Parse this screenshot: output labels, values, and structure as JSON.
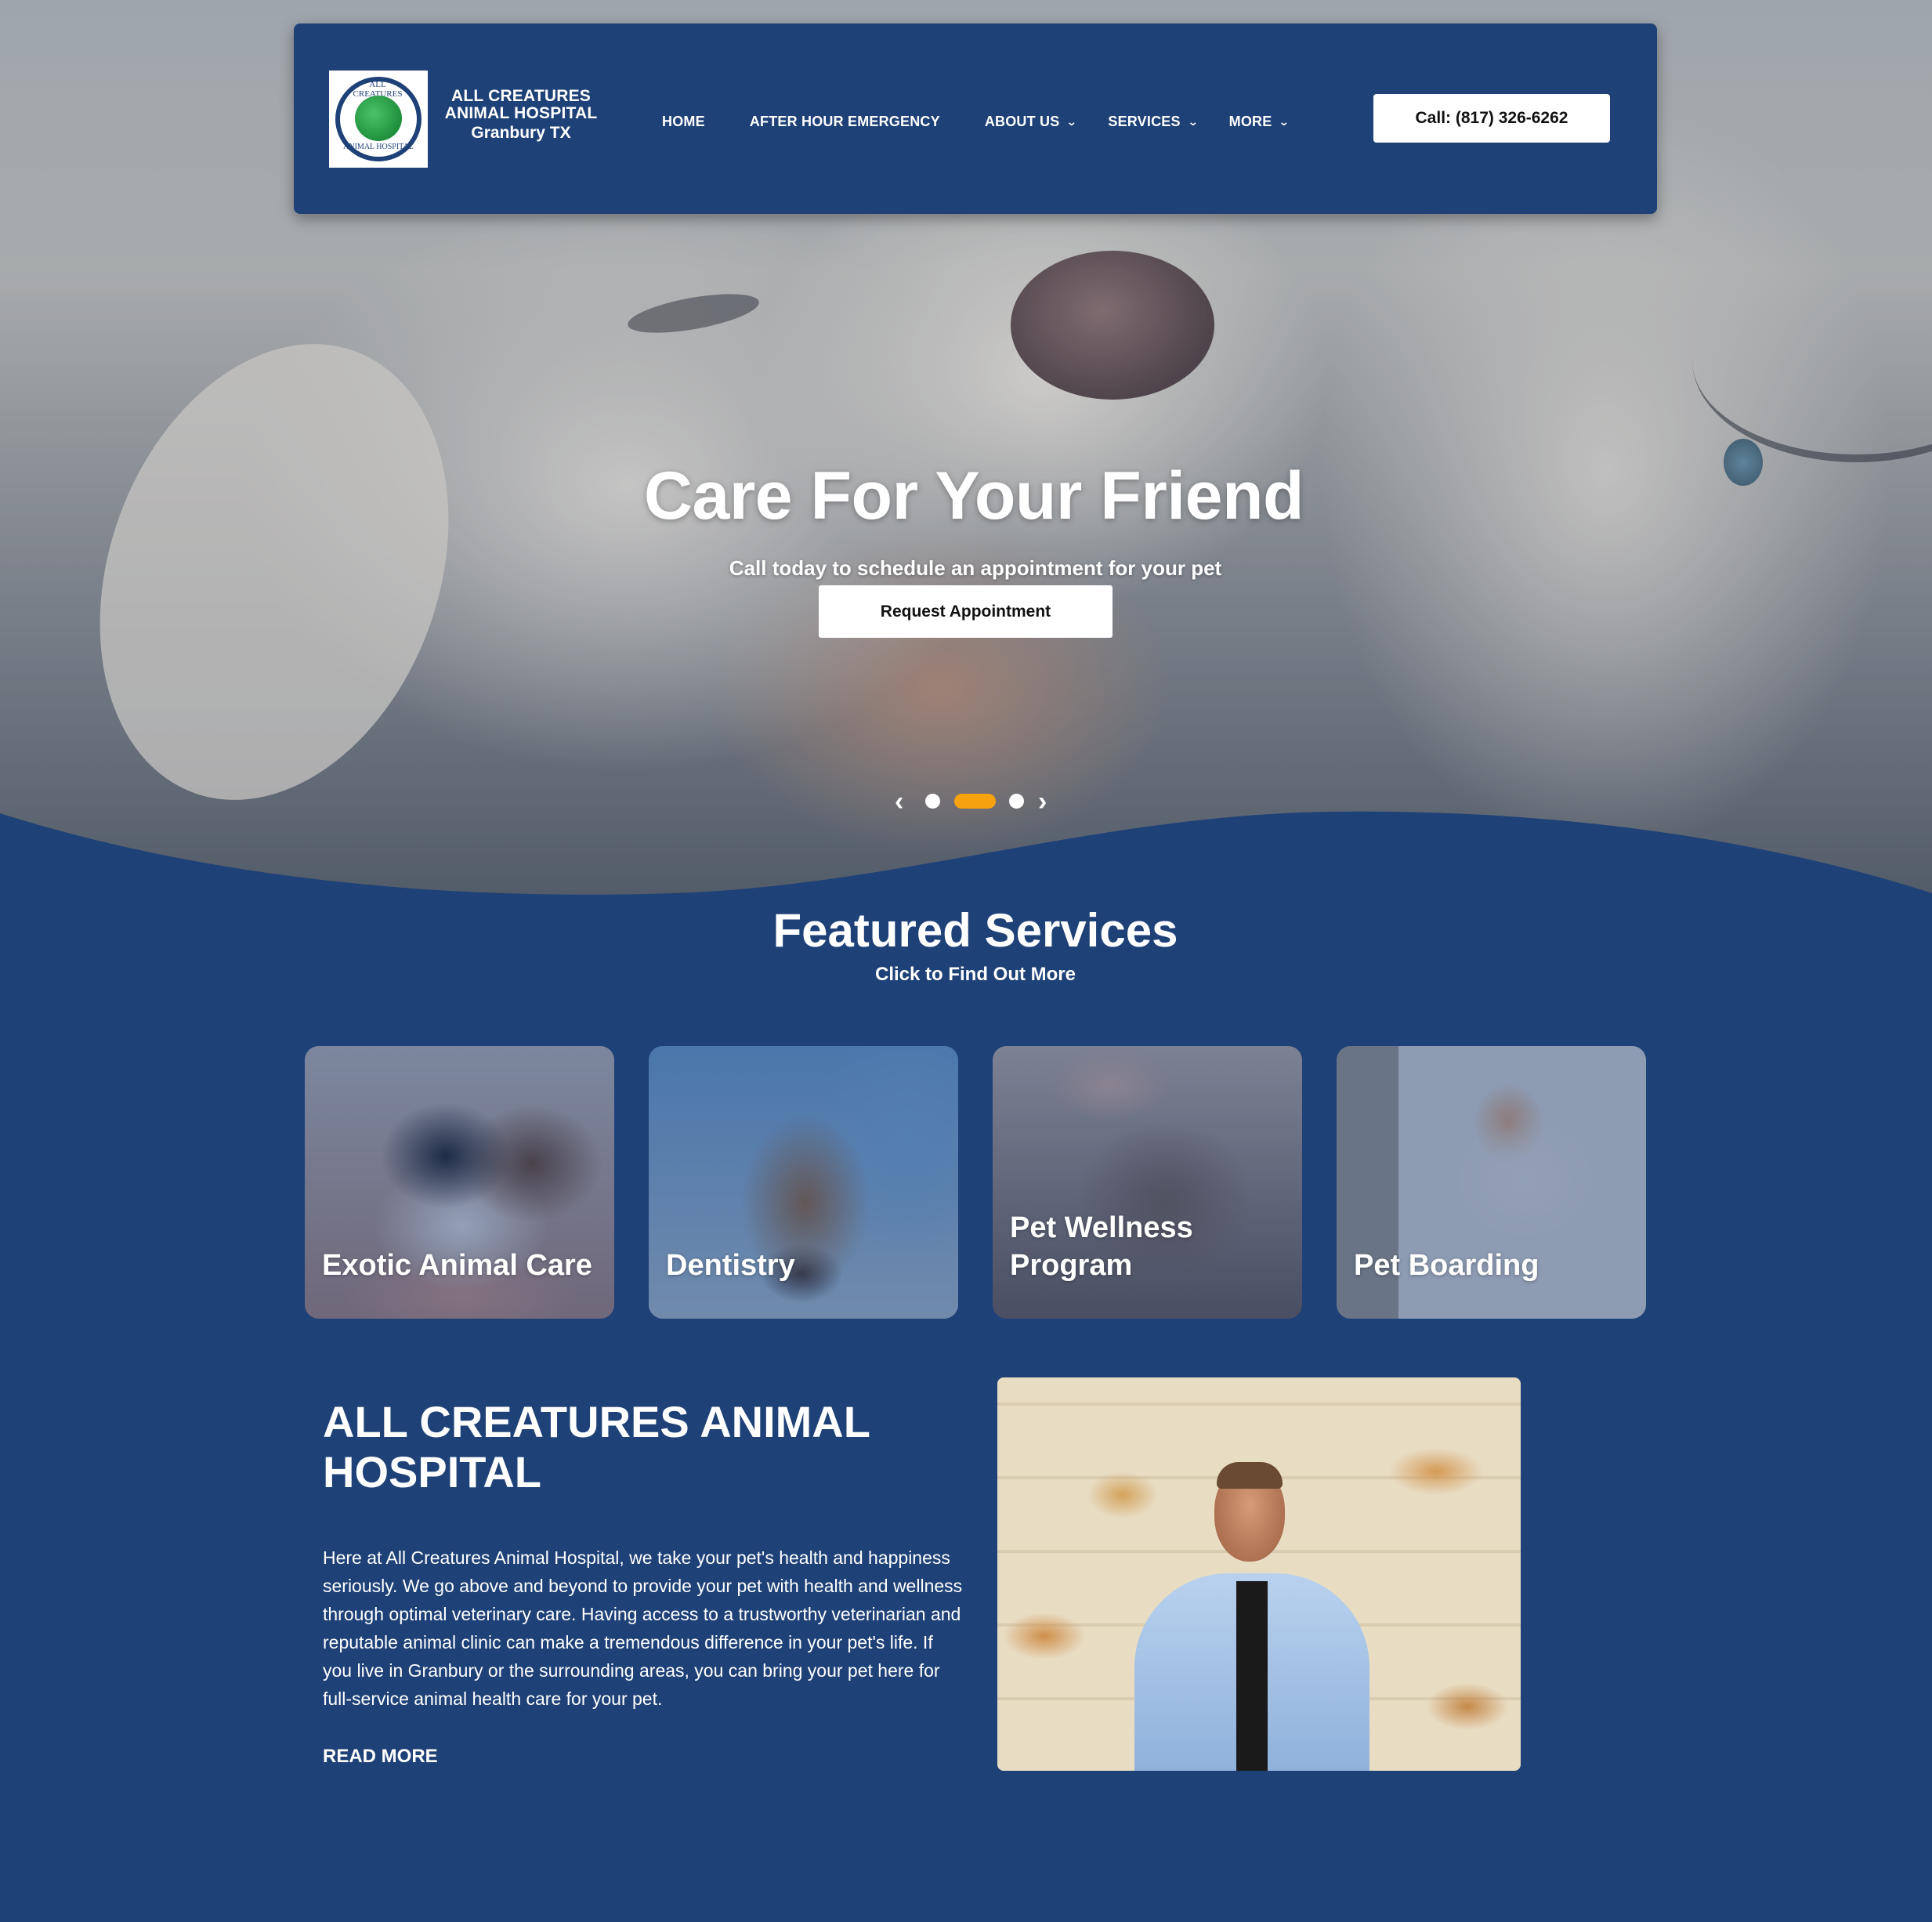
{
  "header": {
    "logo": {
      "alt_icon": "all-creatures-logo",
      "ring_text_top": "ALL CREATURES",
      "ring_text_bottom": "ANIMAL HOSPITAL"
    },
    "brand_line1": "ALL CREATURES",
    "brand_line2": "ANIMAL HOSPITAL",
    "brand_line3": "Granbury TX",
    "nav": [
      {
        "label": "HOME"
      },
      {
        "label": "AFTER HOUR EMERGENCY"
      },
      {
        "label": "ABOUT US",
        "dropdown": true
      },
      {
        "label": "SERVICES",
        "dropdown": true
      },
      {
        "label": "MORE",
        "dropdown": true
      }
    ],
    "call_button": "Call: (817) 326-6262"
  },
  "hero": {
    "title": "Care For Your Friend",
    "subtitle": "Call today to schedule an appointment for your pet",
    "button": "Request Appointment",
    "slider": {
      "prev_icon": "chevron-left-icon",
      "next_icon": "chevron-right-icon",
      "slide_count": 3,
      "active_slide": 2
    }
  },
  "featured": {
    "title": "Featured Services",
    "subtitle": "Click to Find Out More",
    "cards": [
      {
        "label": "Exotic Animal Care"
      },
      {
        "label": "Dentistry"
      },
      {
        "label": "Pet Wellness Program"
      },
      {
        "label": "Pet Boarding"
      }
    ]
  },
  "about": {
    "title": "ALL CREATURES ANIMAL HOSPITAL",
    "text": "Here at All Creatures Animal Hospital, we take your pet's health and happiness seriously. We go above and beyond to provide your pet with health and wellness through optimal veterinary care. Having access to a trustworthy veterinarian and reputable animal clinic can make a tremendous difference in your pet's life. If you live in Granbury or the surrounding areas, you can bring your pet here for full-service animal health care for your pet.",
    "read_more": "READ MORE"
  },
  "colors": {
    "brand_blue": "#1e4177",
    "accent_orange": "#f6a20f",
    "white": "#ffffff"
  }
}
